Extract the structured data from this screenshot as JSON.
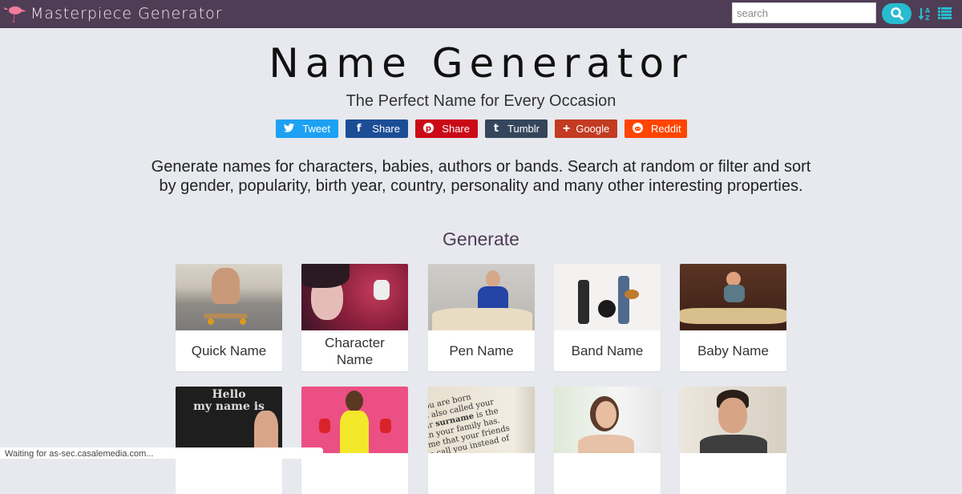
{
  "navbar": {
    "brand": "Masterpiece Generator",
    "search_placeholder": "search",
    "search_value": "",
    "icons": [
      "flamingo-logo-icon",
      "search-icon",
      "sort-alpha-icon",
      "list-icon"
    ]
  },
  "hero": {
    "title": "Name Generator",
    "subtitle": "The Perfect Name for Every Occasion"
  },
  "share": [
    {
      "label": "Tweet",
      "icon": "twitter-icon",
      "color": "#1da1f2"
    },
    {
      "label": "Share",
      "icon": "facebook-icon",
      "color": "#1c4e96"
    },
    {
      "label": "Share",
      "icon": "pinterest-icon",
      "color": "#cb0a17"
    },
    {
      "label": "Tumblr",
      "icon": "tumblr-icon",
      "color": "#35465c"
    },
    {
      "label": "Google",
      "icon": "google-plus-icon",
      "color": "#c23b22"
    },
    {
      "label": "Reddit",
      "icon": "reddit-icon",
      "color": "#ff4500"
    }
  ],
  "description": "Generate names for characters, babies, authors or bands. Search at random or filter and sort by gender, popularity, birth year, country, personality and many other interesting properties.",
  "section_title": "Generate",
  "cards": [
    {
      "label": "Quick Name"
    },
    {
      "label": "Character Name"
    },
    {
      "label": "Pen Name"
    },
    {
      "label": "Band Name"
    },
    {
      "label": "Baby Name"
    },
    {
      "label": ""
    },
    {
      "label": ""
    },
    {
      "label": ""
    },
    {
      "label": ""
    },
    {
      "label": ""
    }
  ],
  "status_bar": "Waiting for as-sec.casalemedia.com...",
  "colors": {
    "navbar": "#4f3d55",
    "accent": "#28bcd0",
    "background": "#e7e9ee"
  }
}
